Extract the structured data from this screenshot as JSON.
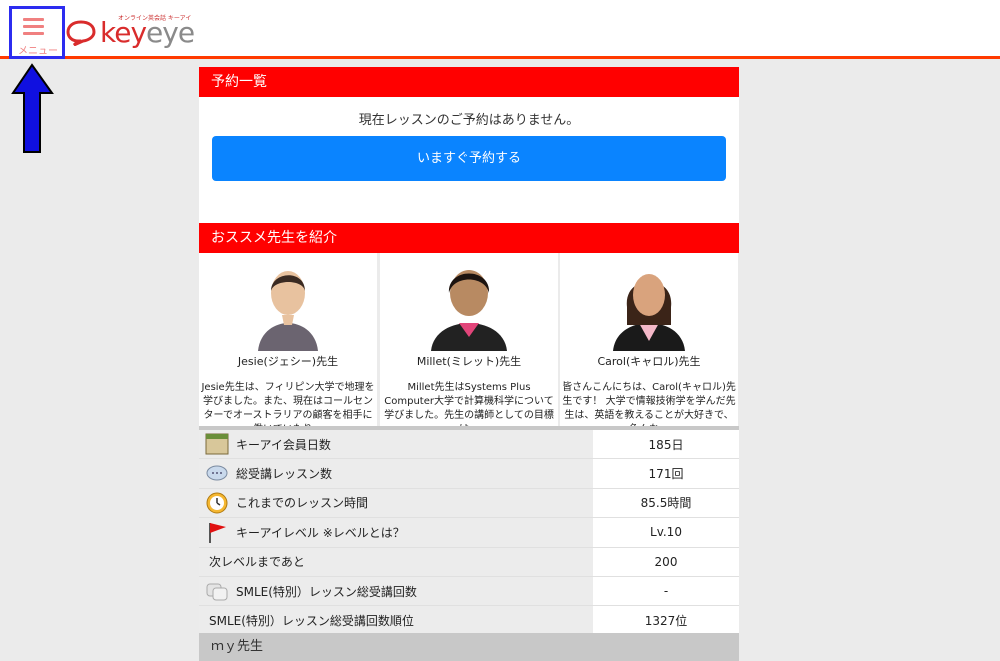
{
  "header": {
    "menu_label": "メニュー",
    "logo_tagline": "オンライン英会話 キーアイ",
    "logo_key": "key",
    "logo_eye": "eye"
  },
  "booking": {
    "section_title": "予約一覧",
    "empty_message": "現在レッスンのご予約はありません。",
    "cta_label": "いますぐ予約する"
  },
  "recommend": {
    "section_title": "おススメ先生を紹介",
    "teachers": [
      {
        "name": "Jesie(ジェシー)先生",
        "desc": "Jesie先生は、フィリピン大学で地理を学びました。また、現在はコールセンターでオーストラリアの顧客を相手に働いていたり…"
      },
      {
        "name": "Millet(ミレット)先生",
        "desc": "Millet先生はSystems Plus Computer大学で計算機科学について学びました。先生の講師としての目標は…"
      },
      {
        "name": "Carol(キャロル)先生",
        "desc": "皆さんこんにちは、Carol(キャロル)先生です！ 大学で情報技術学を学んだ先生は、英語を教えることが大好きで、色んな…"
      }
    ]
  },
  "stats": [
    {
      "label": "キーアイ会員日数",
      "value": "185日",
      "icon": "calendar-icon"
    },
    {
      "label": "総受講レッスン数",
      "value": "171回",
      "icon": "chat-bubbles-icon"
    },
    {
      "label": "これまでのレッスン時間",
      "value": "85.5時間",
      "icon": "clock-icon"
    },
    {
      "label": "キーアイレベル ※レベルとは？",
      "value": "Lv.10",
      "icon": "flag-icon"
    },
    {
      "label": "次レベルまであと",
      "value": "200",
      "icon": ""
    },
    {
      "label": "SMLE(特別）レッスン総受講回数",
      "value": "-",
      "icon": "special-lesson-icon"
    },
    {
      "label": "SMLE(特別）レッスン総受講回数順位",
      "value": "1327位",
      "icon": ""
    }
  ],
  "my_teacher": {
    "section_title": "ｍｙ先生"
  },
  "colors": {
    "accent_red": "#ff0000",
    "cta_blue": "#0a84ff",
    "header_line": "#ff3a00",
    "annotation_blue": "#2c2cf0"
  }
}
